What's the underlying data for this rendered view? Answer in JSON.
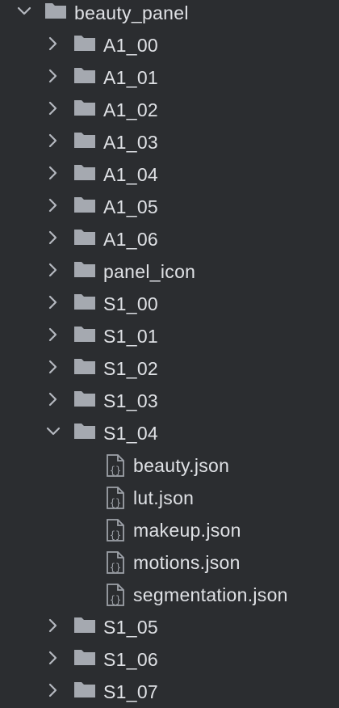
{
  "tree": {
    "root": {
      "label": "beauty_panel",
      "expanded": true
    },
    "children": [
      {
        "label": "A1_00",
        "type": "folder",
        "expanded": false
      },
      {
        "label": "A1_01",
        "type": "folder",
        "expanded": false
      },
      {
        "label": "A1_02",
        "type": "folder",
        "expanded": false
      },
      {
        "label": "A1_03",
        "type": "folder",
        "expanded": false
      },
      {
        "label": "A1_04",
        "type": "folder",
        "expanded": false
      },
      {
        "label": "A1_05",
        "type": "folder",
        "expanded": false
      },
      {
        "label": "A1_06",
        "type": "folder",
        "expanded": false
      },
      {
        "label": "panel_icon",
        "type": "folder",
        "expanded": false
      },
      {
        "label": "S1_00",
        "type": "folder",
        "expanded": false
      },
      {
        "label": "S1_01",
        "type": "folder",
        "expanded": false
      },
      {
        "label": "S1_02",
        "type": "folder",
        "expanded": false
      },
      {
        "label": "S1_03",
        "type": "folder",
        "expanded": false
      },
      {
        "label": "S1_04",
        "type": "folder",
        "expanded": true,
        "files": [
          "beauty.json",
          "lut.json",
          "makeup.json",
          "motions.json",
          "segmentation.json"
        ]
      },
      {
        "label": "S1_05",
        "type": "folder",
        "expanded": false
      },
      {
        "label": "S1_06",
        "type": "folder",
        "expanded": false
      },
      {
        "label": "S1_07",
        "type": "folder",
        "expanded": false
      }
    ]
  },
  "icons": {
    "chevron_right": "chevron-right-icon",
    "chevron_down": "chevron-down-icon",
    "folder": "folder-icon",
    "json_file": "json-file-icon"
  },
  "colors": {
    "background": "#2b2d30",
    "text": "#dfe1e5",
    "chevron": "#b4b8bf",
    "folder": "#a5a9b0",
    "file_icon": "#9ea2a9"
  }
}
